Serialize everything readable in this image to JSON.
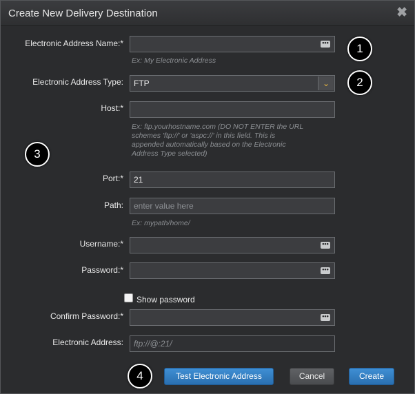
{
  "dialog": {
    "title": "Create New Delivery Destination",
    "close_glyph": "✖"
  },
  "fields": {
    "address_name": {
      "label": "Electronic Address Name:*",
      "value": "",
      "hint": "Ex: My Electronic Address"
    },
    "address_type": {
      "label": "Electronic Address Type:",
      "value": "FTP"
    },
    "host": {
      "label": "Host:*",
      "value": "",
      "hint": "Ex: ftp.yourhostname.com (DO NOT ENTER the URL schemes 'ftp://' or 'aspc://' in this field. This is appended automatically based on the Electronic Address Type selected)"
    },
    "port": {
      "label": "Port:*",
      "value": "21"
    },
    "path": {
      "label": "Path:",
      "placeholder": "enter value here",
      "hint": "Ex: mypath/home/"
    },
    "username": {
      "label": "Username:*",
      "value": ""
    },
    "password": {
      "label": "Password:*",
      "value": ""
    },
    "show_password": {
      "label": "Show password",
      "checked": false
    },
    "confirm_password": {
      "label": "Confirm Password:*",
      "value": ""
    },
    "electronic_address": {
      "label": "Electronic Address:",
      "value": "ftp://@:21/"
    }
  },
  "buttons": {
    "test": "Test Electronic Address",
    "cancel": "Cancel",
    "create": "Create"
  },
  "badges": [
    "1",
    "2",
    "3",
    "4"
  ],
  "icons": {
    "dots_icon": "•••",
    "chevron_icon": "⌄"
  },
  "colors": {
    "dialog_bg": "#2b2c2e",
    "primary_button": "#3380c4",
    "chevron": "#e8b640"
  }
}
